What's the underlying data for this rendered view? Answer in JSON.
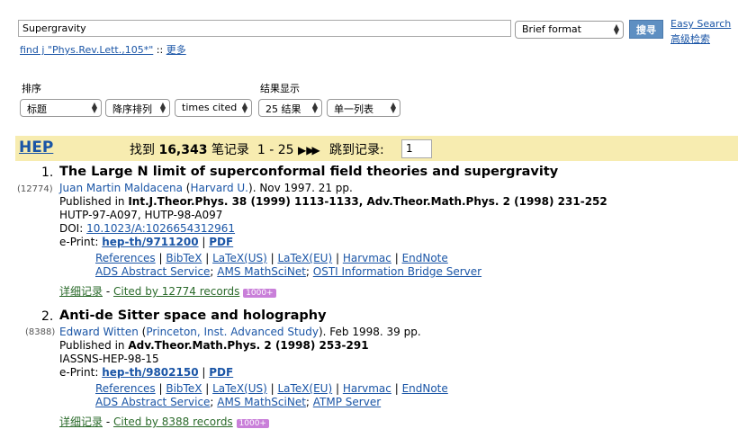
{
  "search": {
    "value": "Supergravity",
    "format": "Brief format",
    "button": "搜寻",
    "easy_search": "Easy Search",
    "advanced": "高级检索"
  },
  "query": {
    "find": "find j \"Phys.Rev.Lett.,105*\"",
    "sep": "::",
    "more": "更多"
  },
  "sort": {
    "label": "排序",
    "display_label": "结果显示",
    "field": "标题",
    "order": "降序排列",
    "rank": "times cited",
    "per_page": "25 结果",
    "view": "单一列表"
  },
  "results": {
    "collection": "HEP",
    "found_prefix": "找到",
    "total": "16,343",
    "records_word": "笔记录",
    "range": "1 - 25",
    "jump_label": "跳到记录:",
    "jump_value": "1"
  },
  "records": [
    {
      "num": "1.",
      "count": "(12774)",
      "title": "The Large N limit of superconformal field theories and supergravity",
      "author": "Juan Martin Maldacena",
      "affil": "Harvard U.",
      "date_pages": ". Nov 1997. 21 pp.",
      "published_prefix": "Published in ",
      "published": "Int.J.Theor.Phys. 38 (1999) 1113-1133, Adv.Theor.Math.Phys. 2 (1998) 231-252",
      "report": "HUTP-97-A097, HUTP-98-A097",
      "doi_label": "DOI: ",
      "doi": "10.1023/A:1026654312961",
      "eprint_label": "e-Print: ",
      "eprint": "hep-th/9711200",
      "pdf": "PDF",
      "links1": [
        "References",
        "BibTeX",
        "LaTeX(US)",
        "LaTeX(EU)",
        "Harvmac",
        "EndNote"
      ],
      "links2": [
        "ADS Abstract Service",
        "AMS MathSciNet",
        "OSTI Information Bridge Server"
      ],
      "detail": "详细记录",
      "cited": "Cited by 12774 records",
      "badge": "1000+"
    },
    {
      "num": "2.",
      "count": "(8388)",
      "title": "Anti-de Sitter space and holography",
      "author": "Edward Witten",
      "affil": "Princeton, Inst. Advanced Study",
      "date_pages": ". Feb 1998. 39 pp.",
      "published_prefix": "Published in ",
      "published": "Adv.Theor.Math.Phys. 2 (1998) 253-291",
      "report": "IASSNS-HEP-98-15",
      "eprint_label": "e-Print: ",
      "eprint": "hep-th/9802150",
      "pdf": "PDF",
      "links1": [
        "References",
        "BibTeX",
        "LaTeX(US)",
        "LaTeX(EU)",
        "Harvmac",
        "EndNote"
      ],
      "links2": [
        "ADS Abstract Service",
        "AMS MathSciNet",
        "ATMP Server"
      ],
      "detail": "详细记录",
      "cited": "Cited by 8388 records",
      "badge": "1000+"
    }
  ]
}
